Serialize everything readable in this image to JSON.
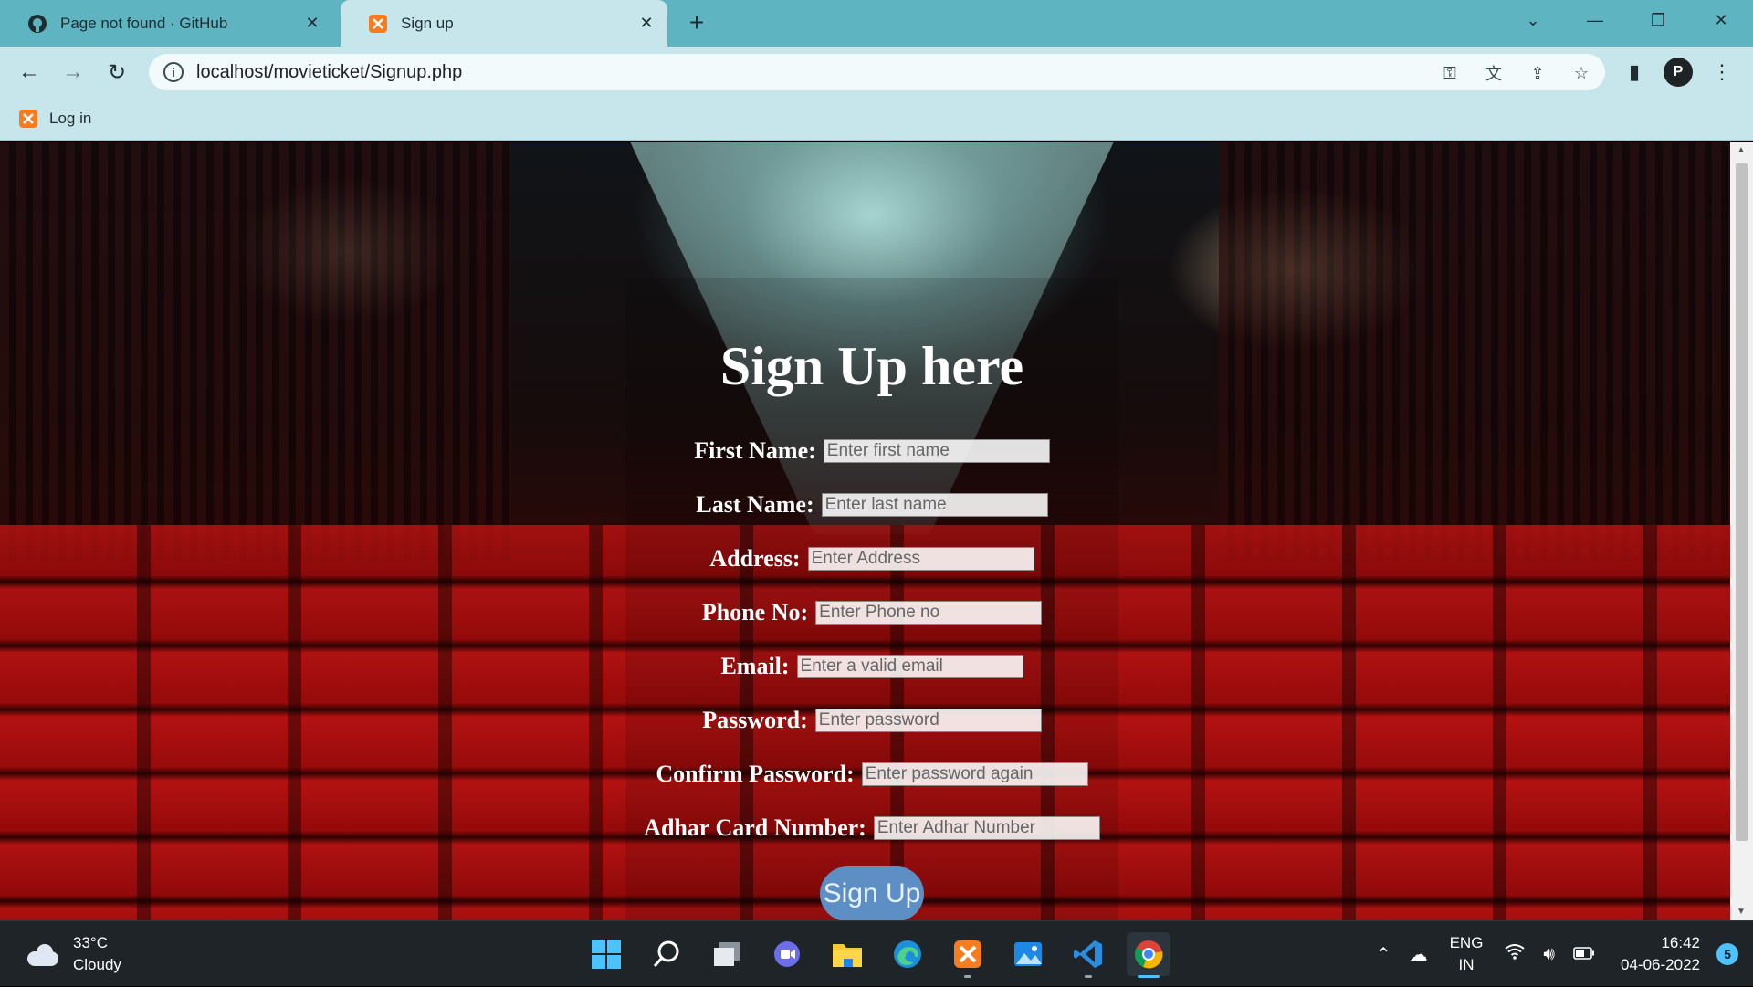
{
  "browser": {
    "tabs": [
      {
        "title": "Page not found · GitHub",
        "favicon": "github-icon"
      },
      {
        "title": "Sign up",
        "favicon": "xampp-icon",
        "active": true
      }
    ],
    "url": "localhost/movieticket/Signup.php",
    "bookmarks": [
      {
        "label": "Log in",
        "favicon": "xampp-icon"
      }
    ],
    "profile_initial": "P",
    "accent_color": "#5fb4c2",
    "toolbar_color": "#c7e6ec"
  },
  "page": {
    "title": "Sign Up here",
    "fields": [
      {
        "label": "First Name:",
        "placeholder": "Enter first name"
      },
      {
        "label": "Last Name:",
        "placeholder": "Enter last name"
      },
      {
        "label": "Address:",
        "placeholder": "Enter Address"
      },
      {
        "label": "Phone No:",
        "placeholder": "Enter Phone no"
      },
      {
        "label": "Email:",
        "placeholder": "Enter a valid email"
      },
      {
        "label": "Password:",
        "placeholder": "Enter password"
      },
      {
        "label": "Confirm Password:",
        "placeholder": "Enter password again"
      },
      {
        "label": "Adhar Card Number:",
        "placeholder": "Enter Adhar Number"
      }
    ],
    "submit_label": "Sign Up",
    "button_color": "#5d8fc4"
  },
  "taskbar": {
    "weather": {
      "temp": "33°C",
      "condition": "Cloudy"
    },
    "apps": [
      "start-icon",
      "search-icon",
      "task-view-icon",
      "teams-chat-icon",
      "file-explorer-icon",
      "edge-icon",
      "xampp-icon",
      "photos-icon",
      "vscode-icon",
      "chrome-icon"
    ],
    "lang": {
      "line1": "ENG",
      "line2": "IN"
    },
    "time": "16:42",
    "date": "04-06-2022",
    "notification_count": "5"
  }
}
